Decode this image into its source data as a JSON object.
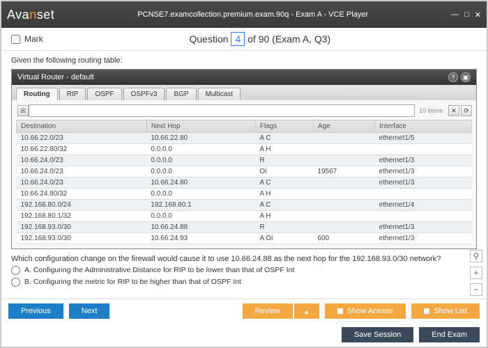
{
  "window": {
    "logo1": "Ava",
    "logo2": "n",
    "logo3": "set",
    "title": "PCNSE7.examcollection.premium.exam.90q - Exam A - VCE Player"
  },
  "qbar": {
    "mark": "Mark",
    "prefix": "Question ",
    "num": "4",
    "suffix": " of 90 (Exam A, Q3)"
  },
  "qtext": "Given the following routing table:",
  "router": {
    "title": "Virtual Router - default"
  },
  "tabs": [
    "Routing",
    "RIP",
    "OSPF",
    "OSPFv3",
    "BGP",
    "Multicast"
  ],
  "items_count": "10 items",
  "cols": [
    "Destination",
    "Next Hop",
    "Flags",
    "Age",
    "Interface"
  ],
  "rows": [
    [
      "10.66.22.0/23",
      "10.66.22.80",
      "A C",
      "",
      "ethernet1/5"
    ],
    [
      "10.66.22.80/32",
      "0.0.0.0",
      "A H",
      "",
      ""
    ],
    [
      "10.66.24.0/23",
      "0.0.0.0",
      "R",
      "",
      "ethernet1/3"
    ],
    [
      "10.66.24.0/23",
      "0.0.0.0",
      "Oi",
      "19567",
      "ethernet1/3"
    ],
    [
      "10.66.24.0/23",
      "10.66.24.80",
      "A C",
      "",
      "ethernet1/3"
    ],
    [
      "10.66.24.80/32",
      "0.0.0.0",
      "A H",
      "",
      ""
    ],
    [
      "192.168.80.0/24",
      "192.168.80.1",
      "A C",
      "",
      "ethernet1/4"
    ],
    [
      "192.168.80.1/32",
      "0.0.0.0",
      "A H",
      "",
      ""
    ],
    [
      "192.168.93.0/30",
      "10.66.24.88",
      "R",
      "",
      "ethernet1/3"
    ],
    [
      "192.168.93.0/30",
      "10.66.24.93",
      "A Oi",
      "600",
      "ethernet1/3"
    ]
  ],
  "qtext2": "Which configuration change on the firewall would cause it to use 10.66.24.88 as the next hop for the 192.168.93.0/30 network?",
  "opts": {
    "a": "A.  Configuring the Administrative Distance for RIP to be lower than that of OSPF Int",
    "b": "B.  Configuring the metric for RIP to be higher than that of OSPF Int"
  },
  "btns": {
    "prev": "Previous",
    "next": "Next",
    "review": "Review",
    "showans": "Show Answer",
    "showlist": "Show List",
    "save": "Save Session",
    "end": "End Exam"
  }
}
